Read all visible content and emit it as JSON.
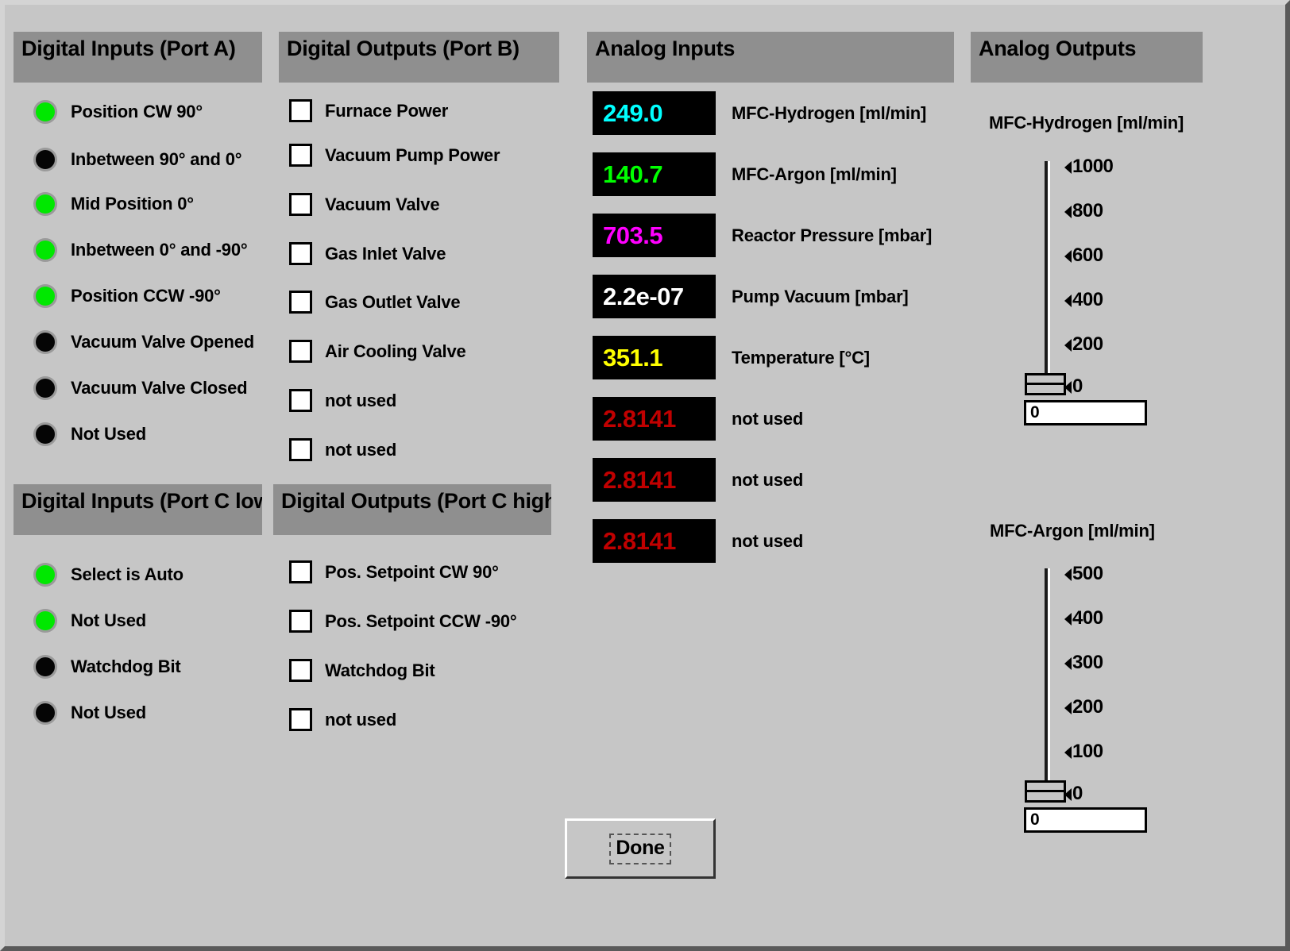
{
  "colors": {
    "window_bg": "#c6c6c6",
    "header_plate": "#8f8f8f",
    "led_on": "#00e800",
    "led_off": "#050505",
    "readout_bg": "#000000"
  },
  "sections": {
    "digital_inputs_a": {
      "title": "Digital Inputs (Port A)",
      "items": [
        {
          "label": "Position CW 90°",
          "state": "on"
        },
        {
          "label": "Inbetween 90° and 0°",
          "state": "off"
        },
        {
          "label": "Mid Position 0°",
          "state": "on"
        },
        {
          "label": "Inbetween 0° and -90°",
          "state": "on"
        },
        {
          "label": "Position CCW -90°",
          "state": "on"
        },
        {
          "label": "Vacuum Valve Opened",
          "state": "off"
        },
        {
          "label": "Vacuum Valve Closed",
          "state": "off"
        },
        {
          "label": "Not Used",
          "state": "off"
        }
      ]
    },
    "digital_inputs_c_low": {
      "title": "Digital Inputs (Port C low)",
      "items": [
        {
          "label": "Select is Auto",
          "state": "on"
        },
        {
          "label": "Not Used",
          "state": "on"
        },
        {
          "label": "Watchdog Bit",
          "state": "off"
        },
        {
          "label": "Not Used",
          "state": "off"
        }
      ]
    },
    "digital_outputs_b": {
      "title": "Digital Outputs (Port B)",
      "items": [
        {
          "label": "Furnace Power",
          "checked": false
        },
        {
          "label": "Vacuum Pump Power",
          "checked": false
        },
        {
          "label": "Vacuum Valve",
          "checked": false
        },
        {
          "label": "Gas Inlet Valve",
          "checked": false
        },
        {
          "label": "Gas Outlet Valve",
          "checked": false
        },
        {
          "label": "Air Cooling Valve",
          "checked": false
        },
        {
          "label": "not used",
          "checked": false
        },
        {
          "label": "not used",
          "checked": false
        }
      ]
    },
    "digital_outputs_c_high": {
      "title": "Digital Outputs (Port C high)",
      "items": [
        {
          "label": "Pos. Setpoint CW 90°",
          "checked": false
        },
        {
          "label": "Pos. Setpoint CCW -90°",
          "checked": false
        },
        {
          "label": "Watchdog Bit",
          "checked": false
        },
        {
          "label": "not used",
          "checked": false
        }
      ]
    },
    "analog_inputs": {
      "title": "Analog Inputs",
      "items": [
        {
          "value": "249.0",
          "color": "#00ffff",
          "label": "MFC-Hydrogen [ml/min]"
        },
        {
          "value": "140.7",
          "color": "#00ff00",
          "label": "MFC-Argon [ml/min]"
        },
        {
          "value": "703.5",
          "color": "#ff00ff",
          "label": "Reactor Pressure [mbar]"
        },
        {
          "value": "2.2e-07",
          "color": "#ffffff",
          "label": "Pump Vacuum [mbar]"
        },
        {
          "value": "351.1",
          "color": "#ffff00",
          "label": "Temperature [°C]"
        },
        {
          "value": "2.8141",
          "color": "#c00000",
          "label": "not used"
        },
        {
          "value": "2.8141",
          "color": "#c00000",
          "label": "not used"
        },
        {
          "value": "2.8141",
          "color": "#c00000",
          "label": "not used"
        }
      ]
    },
    "analog_outputs": {
      "title": "Analog Outputs",
      "sliders": [
        {
          "title": "MFC-Hydrogen [ml/min]",
          "ticks": [
            "1000",
            "800",
            "600",
            "400",
            "200",
            "0"
          ],
          "thumb_tick": "0",
          "value": "0"
        },
        {
          "title": "MFC-Argon [ml/min]",
          "ticks": [
            "500",
            "400",
            "300",
            "200",
            "100",
            "0"
          ],
          "thumb_tick": "0",
          "value": "0"
        }
      ]
    }
  },
  "buttons": {
    "done": "Done"
  }
}
